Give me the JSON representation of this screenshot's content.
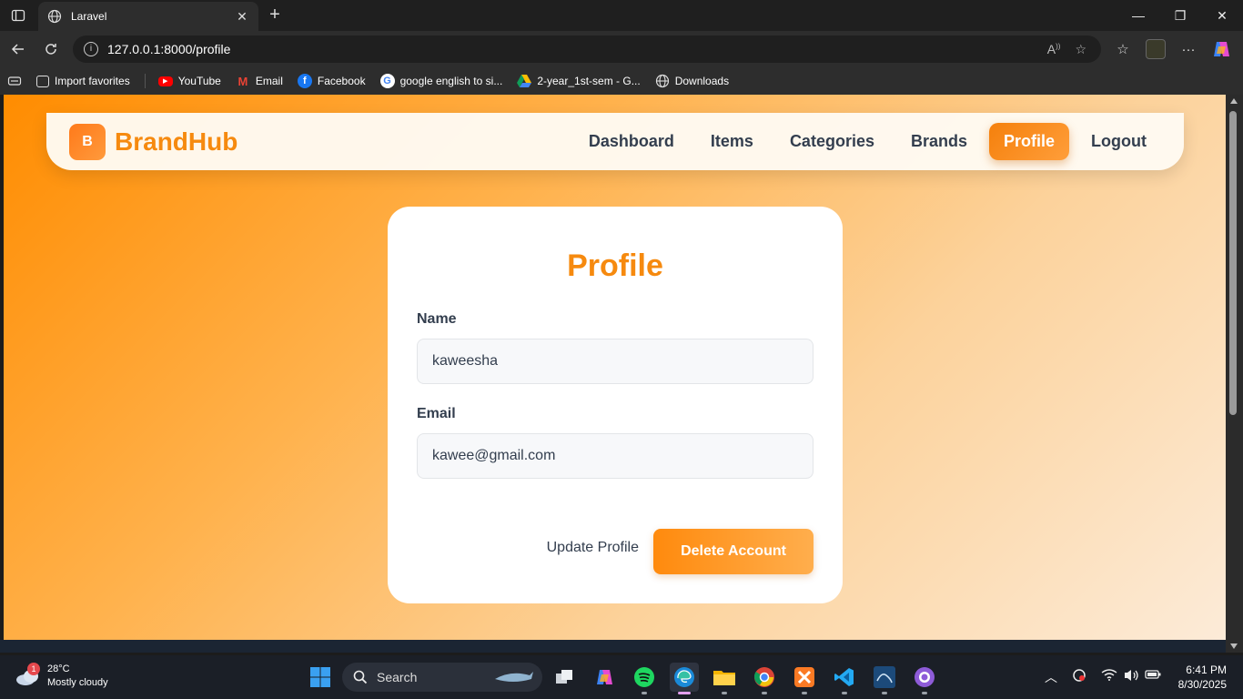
{
  "browser": {
    "tab_title": "Laravel",
    "url": "127.0.0.1:8000/profile",
    "favorites": [
      {
        "label": "Import favorites",
        "icon": "import-icon"
      },
      {
        "label": "YouTube",
        "icon": "youtube-icon"
      },
      {
        "label": "Email",
        "icon": "gmail-icon"
      },
      {
        "label": "Facebook",
        "icon": "facebook-icon"
      },
      {
        "label": "google english to si...",
        "icon": "google-icon"
      },
      {
        "label": "2-year_1st-sem - G...",
        "icon": "drive-icon"
      },
      {
        "label": "Downloads",
        "icon": "globe-icon"
      }
    ]
  },
  "navbar": {
    "logo_letter": "B",
    "brand": "BrandHub",
    "links": [
      {
        "label": "Dashboard",
        "active": false
      },
      {
        "label": "Items",
        "active": false
      },
      {
        "label": "Categories",
        "active": false
      },
      {
        "label": "Brands",
        "active": false
      },
      {
        "label": "Profile",
        "active": true
      },
      {
        "label": "Logout",
        "active": false
      }
    ]
  },
  "profile": {
    "title": "Profile",
    "name_label": "Name",
    "name_value": "kaweesha",
    "email_label": "Email",
    "email_value": "kawee@gmail.com",
    "update_label": "Update Profile",
    "delete_label": "Delete Account"
  },
  "taskbar": {
    "weather_badge": "1",
    "temperature": "28°C",
    "weather_desc": "Mostly cloudy",
    "search_label": "Search",
    "time": "6:41 PM",
    "date": "8/30/2025"
  },
  "colors": {
    "accent": "#f68a0f",
    "text_dark": "#333e4e"
  }
}
